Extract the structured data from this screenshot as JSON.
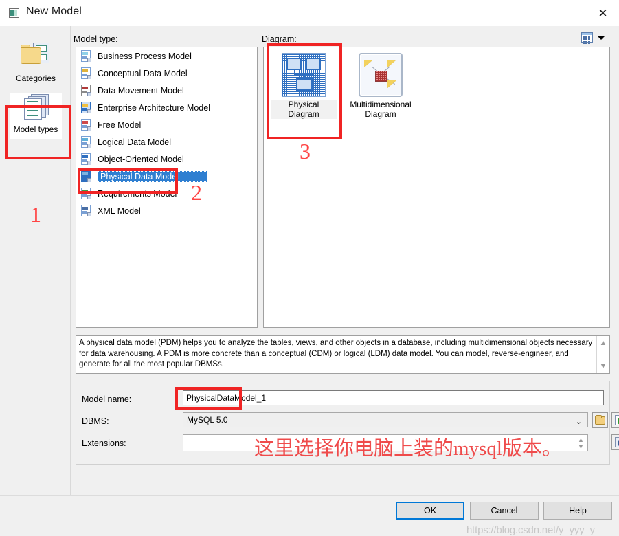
{
  "window": {
    "title": "New Model",
    "icon": "app-window-icon",
    "close_label": "✕"
  },
  "labels": {
    "model_type": "Model type:",
    "diagram": "Diagram:"
  },
  "view_mode": {
    "icon": "grid-view-icon",
    "caret": "▼"
  },
  "rail": {
    "items": [
      {
        "label": "Categories",
        "icon": "folder-pages-icon",
        "selected": false
      },
      {
        "label": "Model types",
        "icon": "stacked-pages-icon",
        "selected": true
      }
    ]
  },
  "model_types": [
    {
      "label": "Business Process Model",
      "selected": false
    },
    {
      "label": "Conceptual Data Model",
      "selected": false
    },
    {
      "label": "Data Movement Model",
      "selected": false
    },
    {
      "label": "Enterprise Architecture Model",
      "selected": false
    },
    {
      "label": "Free Model",
      "selected": false
    },
    {
      "label": "Logical Data Model",
      "selected": false
    },
    {
      "label": "Object-Oriented Model",
      "selected": false
    },
    {
      "label": "Physical Data Model",
      "selected": true
    },
    {
      "label": "Requirements Model",
      "selected": false
    },
    {
      "label": "XML Model",
      "selected": false
    }
  ],
  "diagrams": [
    {
      "label": "Physical Diagram",
      "selected": true,
      "icon": "physical-diagram-thumb"
    },
    {
      "label": "Multidimensional Diagram",
      "selected": false,
      "icon": "multidimensional-diagram-thumb"
    }
  ],
  "description": "A physical data model (PDM) helps you to analyze the tables, views, and other objects in a database, including multidimensional objects necessary for data warehousing. A PDM is more concrete than a conceptual (CDM) or logical (LDM) data model. You can model, reverse-engineer, and generate for all the most popular DBMSs.",
  "form": {
    "model_name_label": "Model name:",
    "model_name_value": "PhysicalDataModel_1",
    "model_name_placeholder": "",
    "dbms_label": "DBMS:",
    "dbms_value": "MySQL 5.0",
    "dbms_chevron": "⌄",
    "extensions_label": "Extensions:",
    "extensions_value": "",
    "extensions_placeholder": "",
    "browse_dbms_icon": "folder-open-icon",
    "new_dbms_icon": "document-arrow-icon",
    "extensions_props_icon": "document-magnifier-icon"
  },
  "footer": {
    "ok": "OK",
    "cancel": "Cancel",
    "help": "Help"
  },
  "annotations": {
    "num1": "1",
    "num2": "2",
    "num3": "3",
    "chinese_note": "这里选择你电脑上装的mysql版本。",
    "accent_color": "#f02424"
  },
  "watermark": "https://blog.csdn.net/y_yyy_y"
}
